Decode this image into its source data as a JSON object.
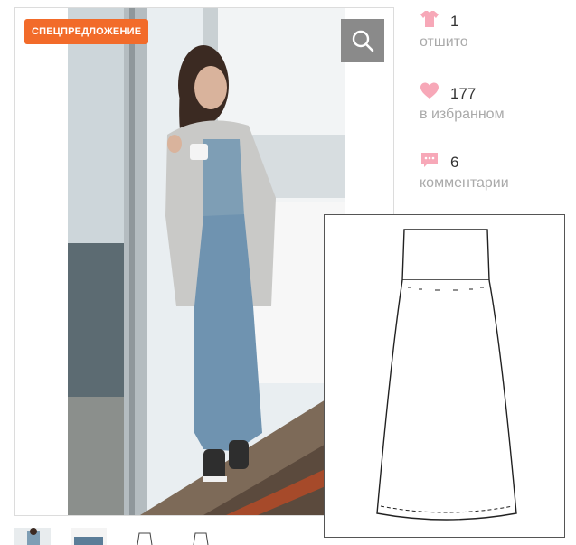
{
  "product": {
    "badge": "СПЕЦПРЕДЛОЖЕНИЕ",
    "zoom_icon": "search-icon"
  },
  "stats": [
    {
      "icon": "tshirt-icon",
      "value": "1",
      "label": "отшито",
      "color": "#f7a8b8"
    },
    {
      "icon": "heart-icon",
      "value": "177",
      "label": "в избранном",
      "color": "#f7a8b8"
    },
    {
      "icon": "comment-icon",
      "value": "6",
      "label": "комментарии",
      "color": "#f7a8b8"
    }
  ],
  "colors": {
    "badge_bg": "#f26b2a",
    "zoom_bg": "#8a8a8a",
    "stat_label": "#aaaaaa",
    "accent_pink": "#f7a8b8"
  }
}
